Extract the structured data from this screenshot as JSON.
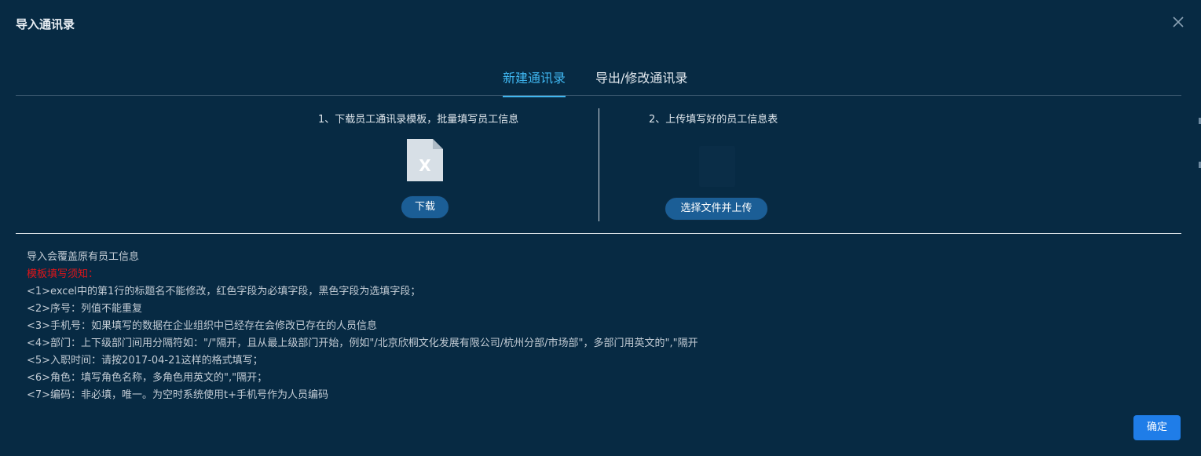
{
  "dialog": {
    "title": "导入通讯录",
    "close_icon": "close-icon"
  },
  "tabs": [
    {
      "label": "新建通讯录",
      "active": true
    },
    {
      "label": "导出/修改通讯录",
      "active": false
    }
  ],
  "step1": {
    "text": "1、下载员工通讯录模板，批量填写员工信息",
    "icon": "excel-file-icon",
    "icon_letter": "X",
    "button": "下载"
  },
  "step2": {
    "text": "2、上传填写好的员工信息表",
    "button": "选择文件并上传"
  },
  "notes": {
    "intro": "导入会覆盖原有员工信息",
    "heading": "模板填写须知：",
    "rules": [
      "<1>excel中的第1行的标题名不能修改，红色字段为必填字段，黑色字段为选填字段；",
      "<2>序号：列值不能重复",
      "<3>手机号：如果填写的数据在企业组织中已经存在会修改已存在的人员信息",
      "<4>部门：上下级部门间用分隔符如：\"/\"隔开，且从最上级部门开始，例如\"/北京欣桐文化发展有限公司/杭州分部/市场部\"，多部门用英文的\",\"隔开",
      "<5>入职时间：请按2017-04-21这样的格式填写；",
      "<6>角色：填写角色名称，多角色用英文的\",\"隔开；",
      "<7>编码：非必填，唯一。为空时系统使用t+手机号作为人员编码"
    ]
  },
  "footer": {
    "ok_button": "确定"
  },
  "colors": {
    "background": "#072a43",
    "accent": "#3fb6f0",
    "primary_button": "#1f7de8",
    "warning_text": "#e0151a"
  }
}
